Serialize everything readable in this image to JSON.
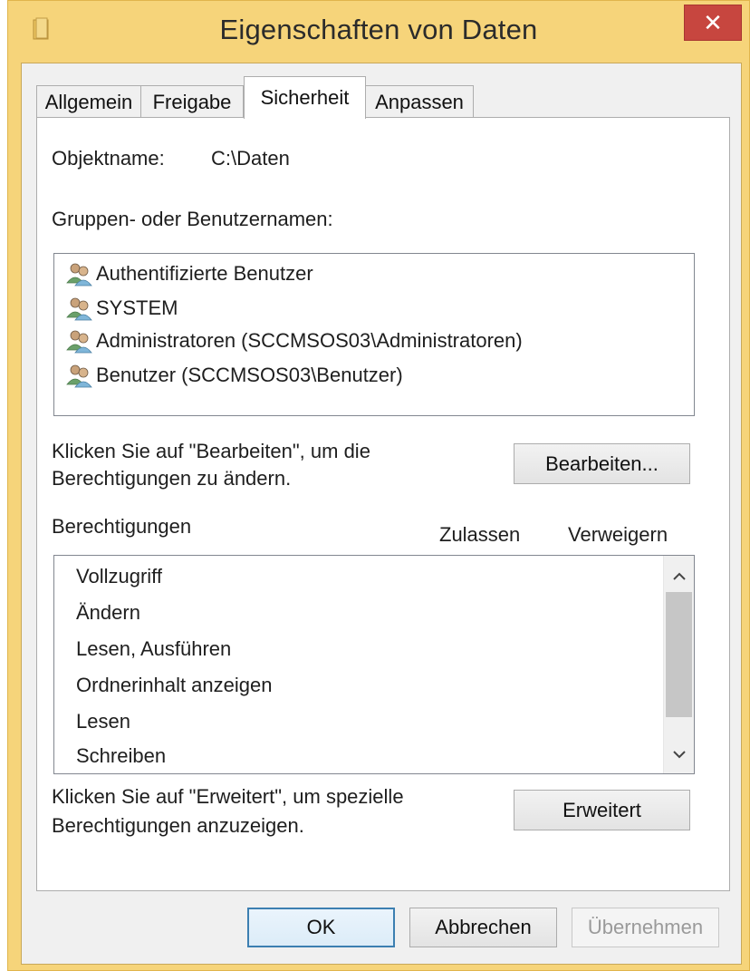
{
  "window": {
    "title": "Eigenschaften von Daten",
    "close_glyph": "✕"
  },
  "tabs": [
    {
      "label": "Allgemein"
    },
    {
      "label": "Freigabe"
    },
    {
      "label": "Sicherheit",
      "active": true
    },
    {
      "label": "Anpassen"
    }
  ],
  "security": {
    "object_label": "Objektname:",
    "object_value": "C:\\Daten",
    "groups_label": "Gruppen- oder Benutzernamen:",
    "users": [
      {
        "name": "Authentifizierte Benutzer",
        "icon": "user-group-icon"
      },
      {
        "name": "SYSTEM",
        "icon": "user-group-icon"
      },
      {
        "name": "Administratoren (SCCMSOS03\\Administratoren)",
        "icon": "user-group-icon"
      },
      {
        "name": "Benutzer (SCCMSOS03\\Benutzer)",
        "icon": "user-group-icon"
      }
    ],
    "edit_hint_line1": "Klicken Sie auf \"Bearbeiten\", um die",
    "edit_hint_line2": "Berechtigungen zu ändern.",
    "edit_button": "Bearbeiten...",
    "permissions_label": "Berechtigungen",
    "col_allow": "Zulassen",
    "col_deny": "Verweigern",
    "permissions": [
      {
        "name": "Vollzugriff"
      },
      {
        "name": "Ändern"
      },
      {
        "name": "Lesen, Ausführen"
      },
      {
        "name": "Ordnerinhalt anzeigen"
      },
      {
        "name": "Lesen"
      },
      {
        "name": "Schreiben"
      }
    ],
    "advanced_hint_line1": "Klicken Sie auf \"Erweitert\", um spezielle",
    "advanced_hint_line2": "Berechtigungen anzuzeigen.",
    "advanced_button": "Erweitert"
  },
  "footer": {
    "ok": "OK",
    "cancel": "Abbrechen",
    "apply": "Übernehmen"
  },
  "colors": {
    "frame": "#f6d47a",
    "close": "#c7463f",
    "panel": "#ffffff"
  }
}
